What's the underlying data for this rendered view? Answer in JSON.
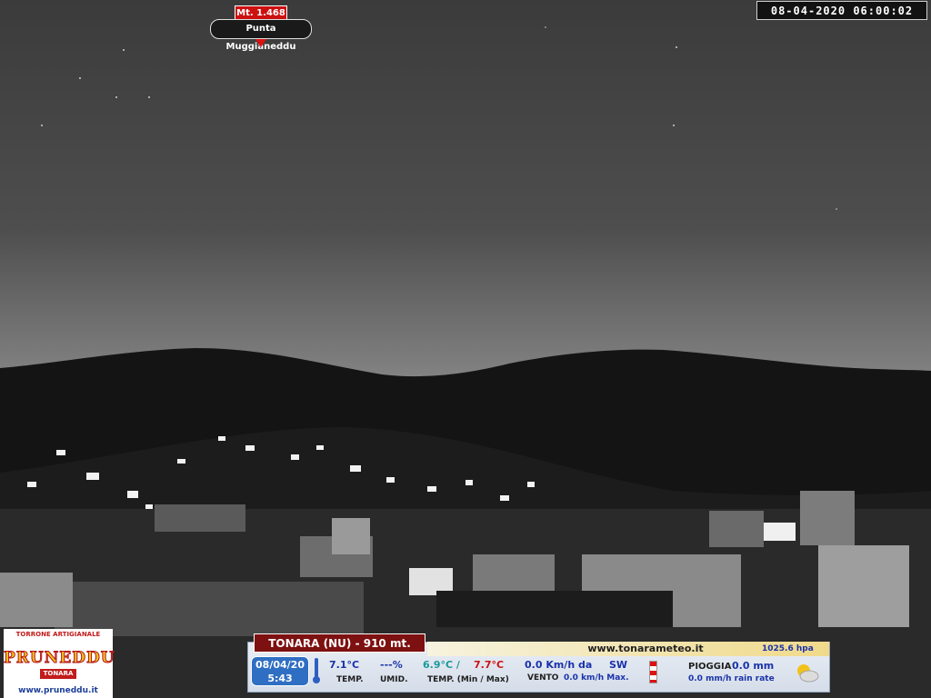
{
  "timestamp": "08-04-2020  06:00:02",
  "peak": {
    "altitude": "Mt. 1.468",
    "name": "Punta Muggianeddu"
  },
  "sponsor": {
    "tagline": "TORRONE ARTIGIANALE",
    "brand": "PRUNEDDU",
    "town": "TONARA",
    "url": "www.pruneddu.it"
  },
  "weather": {
    "station": "TONARA (NU) - 910 mt.",
    "site": "www.tonarameteo.it",
    "pressure": "1025.6  hpa",
    "date": "08/04/20",
    "time": "5:43",
    "temp": "7.1°C",
    "temp_label": "TEMP.",
    "humidity": "---%",
    "humidity_label": "UMID.",
    "temp_min": "6.9°C /",
    "temp_max": "7.7°C",
    "minmax_label": "TEMP. (Min / Max)",
    "wind": "0.0  Km/h da",
    "wind_dir": "SW",
    "wind_label": "VENTO",
    "wind_max": "0.0  km/h Max.",
    "rain_label": "PIOGGIA",
    "rain": "0.0  mm",
    "rain_rate": "0.0 mm/h rain rate"
  },
  "colors": {
    "accent_red": "#cc1111",
    "station_bar": "#7d1010",
    "info_blue": "#1a33aa",
    "date_box": "#2f6fc3"
  },
  "icons": {
    "thermometer": "thermometer-icon",
    "windsock": "windsock-icon",
    "weather": "partly-cloudy-icon"
  }
}
